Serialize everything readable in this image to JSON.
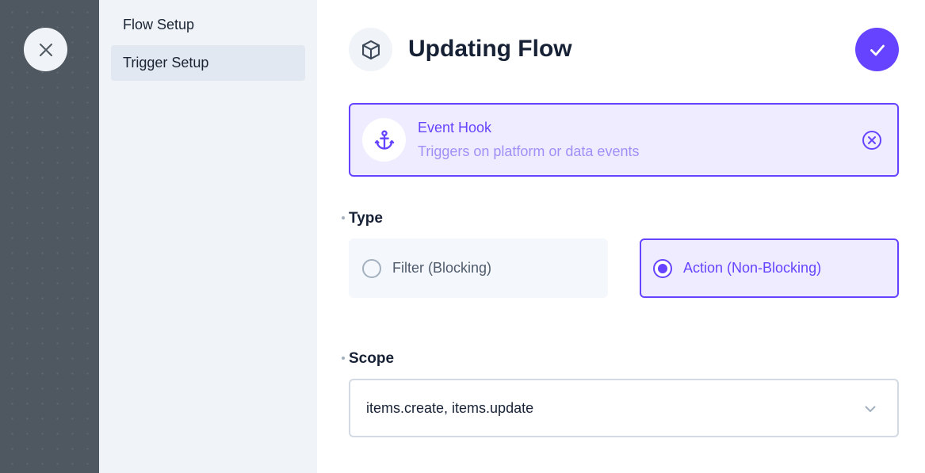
{
  "rail": {
    "close_icon": "close-icon"
  },
  "nav": {
    "items": [
      {
        "label": "Flow Setup",
        "active": false
      },
      {
        "label": "Trigger Setup",
        "active": true
      }
    ]
  },
  "header": {
    "icon": "box-icon",
    "title": "Updating Flow",
    "confirm_icon": "check-icon"
  },
  "trigger": {
    "icon": "anchor-icon",
    "title": "Event Hook",
    "subtitle": "Triggers on platform or data events",
    "remove_icon": "close-circle-icon"
  },
  "type_field": {
    "label": "Type",
    "options": [
      {
        "label": "Filter (Blocking)",
        "selected": false
      },
      {
        "label": "Action (Non-Blocking)",
        "selected": true
      }
    ]
  },
  "scope_field": {
    "label": "Scope",
    "value": "items.create, items.update"
  },
  "colors": {
    "accent": "#6644ff",
    "rail": "#4f5860",
    "nav_bg": "#f0f4f9",
    "accent_bg": "#f0ecff"
  }
}
